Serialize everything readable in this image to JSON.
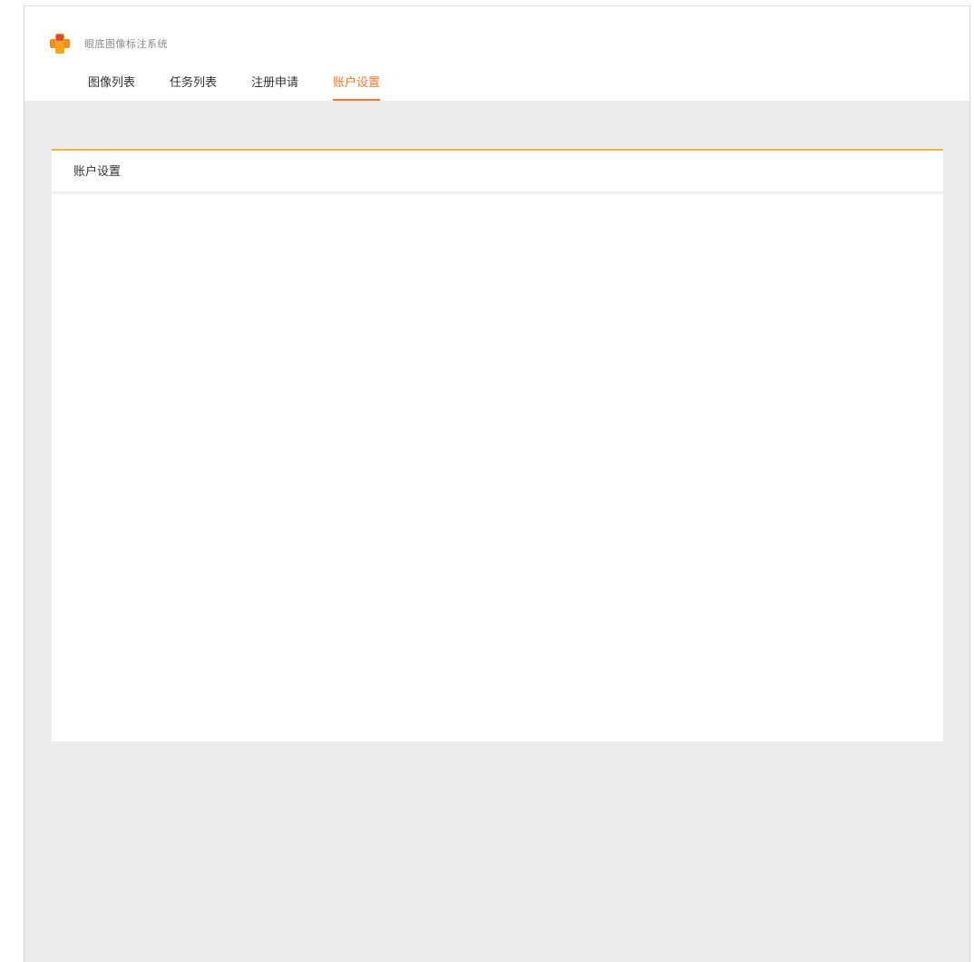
{
  "header": {
    "system_title": "眼底图像标注系统",
    "logo": "plus-logo-icon"
  },
  "nav": {
    "items": [
      {
        "label": "图像列表",
        "active": false
      },
      {
        "label": "任务列表",
        "active": false
      },
      {
        "label": "注册申请",
        "active": false
      },
      {
        "label": "账户设置",
        "active": true
      }
    ]
  },
  "panel": {
    "title": "账户设置"
  },
  "colors": {
    "accent": "#f07a2a",
    "panel_top_border": "#f6b24a",
    "background": "#ececec"
  }
}
